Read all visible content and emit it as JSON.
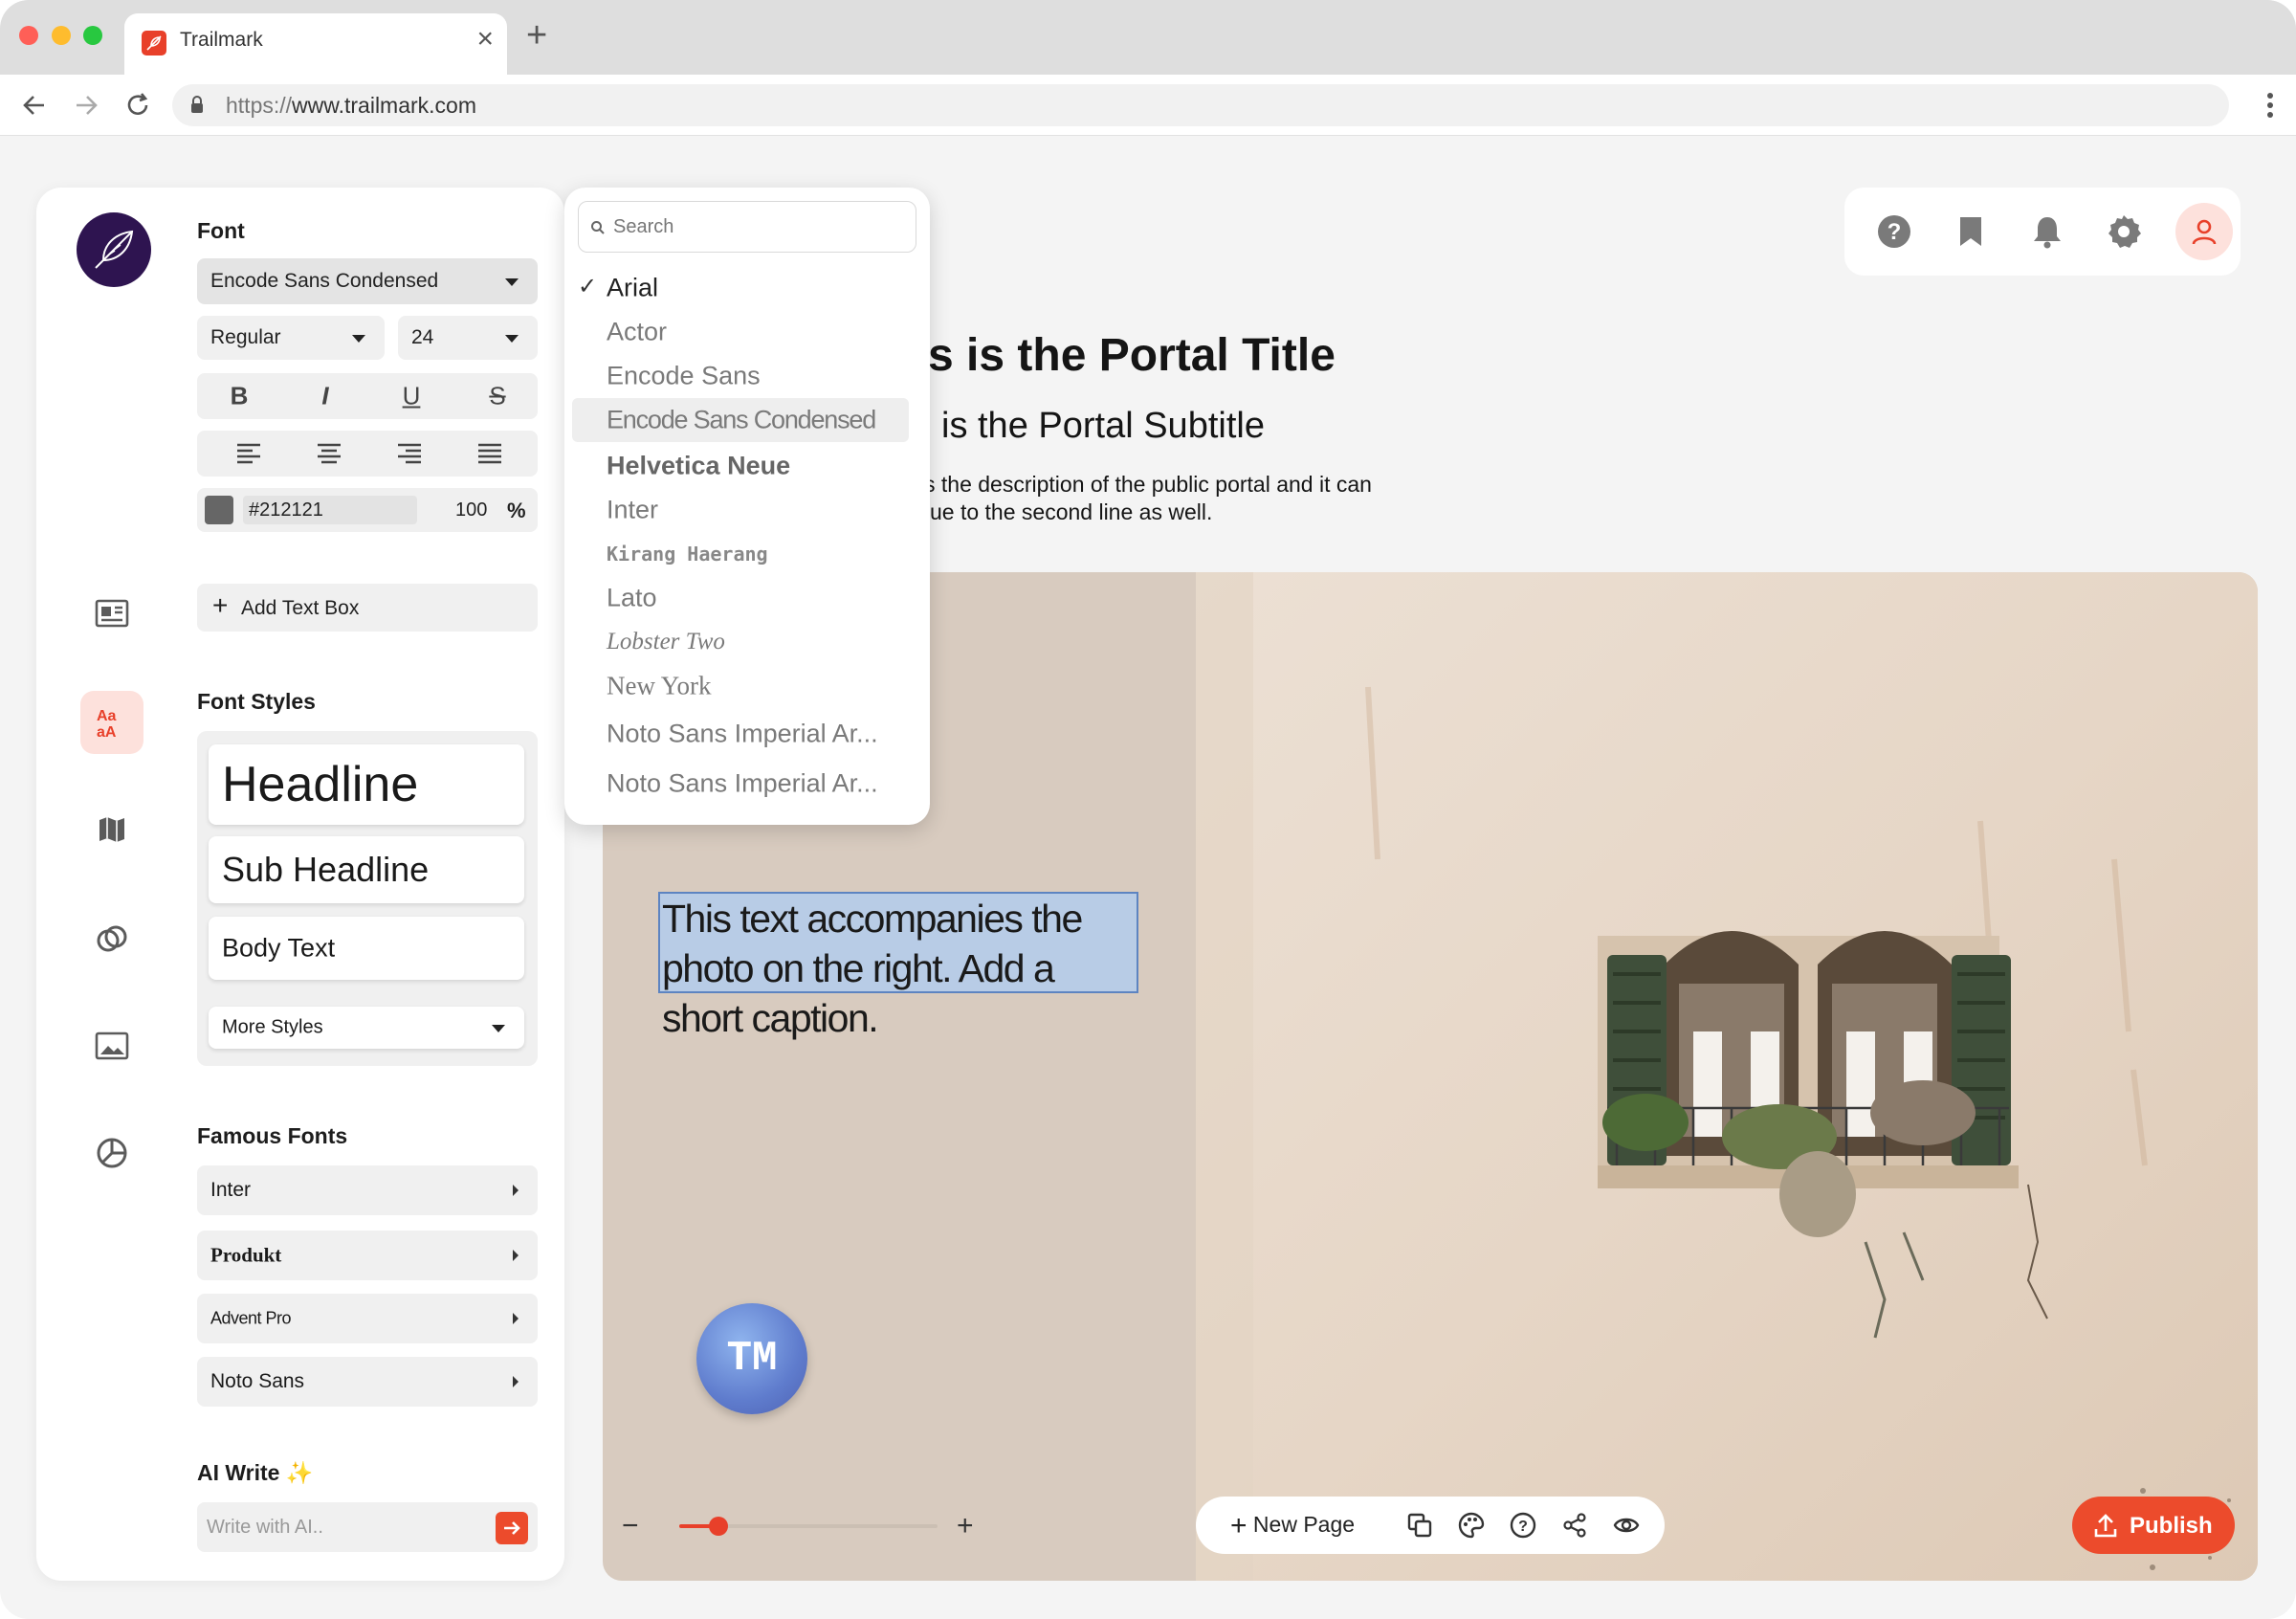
{
  "browser": {
    "tab_title": "Trailmark",
    "url_scheme": "https://",
    "url_host": "www.trailmark.com"
  },
  "text_panel": {
    "font_section_title": "Font",
    "font_family": "Encode Sans Condensed",
    "font_weight": "Regular",
    "font_size": "24",
    "format_buttons": [
      "B",
      "I",
      "U",
      "S"
    ],
    "color_hex": "#212121",
    "opacity": "100",
    "opacity_unit": "%",
    "add_text_box": "Add Text Box",
    "font_styles_title": "Font Styles",
    "styles": [
      "Headline",
      "Sub Headline",
      "Body Text"
    ],
    "more_styles": "More Styles",
    "famous_fonts_title": "Famous Fonts",
    "famous_fonts": [
      "Inter",
      "Produkt",
      "Advent Pro",
      "Noto Sans"
    ],
    "ai_write_title": "AI Write",
    "ai_write_sparkle": "✨",
    "ai_placeholder": "Write with AI.."
  },
  "font_dropdown": {
    "search_placeholder": "Search",
    "selected": "Arial",
    "highlighted": "Encode Sans Condensed",
    "items": [
      "Arial",
      "Actor",
      "Encode Sans",
      "Encode Sans Condensed",
      "Helvetica Neue",
      "Inter",
      "Kirang Haerang",
      "Lato",
      "Lobster Two",
      "New York",
      "Noto Sans Imperial Ar...",
      "Noto Sans Imperial Ar..."
    ]
  },
  "portal": {
    "title": "s is the Portal Title",
    "subtitle": "is the Portal Subtitle",
    "description_line1": "s the description of the public portal and it can",
    "description_line2": "ue to the second line as well."
  },
  "canvas": {
    "caption": "This text accompanies the photo on the right. Add a short caption.",
    "avatar_initials": "TM",
    "zoom_minus": "−",
    "zoom_plus": "+",
    "zoom_level": 0.15,
    "new_page": "New Page",
    "publish": "Publish"
  },
  "colors": {
    "accent": "#ec4b2c",
    "canvas_bg": "#d8cbbf",
    "selection": "#b8cce6"
  },
  "icons": {
    "rail": [
      "newspaper-icon",
      "font-styles-icon",
      "map-icon",
      "rings-icon",
      "image-icon",
      "chart-icon"
    ],
    "top": [
      "help-icon",
      "bookmark-icon",
      "bell-icon",
      "gear-icon",
      "profile-icon"
    ],
    "bottom_bar": [
      "copy-icon",
      "palette-icon",
      "help-icon",
      "share-icon",
      "eye-icon"
    ]
  }
}
